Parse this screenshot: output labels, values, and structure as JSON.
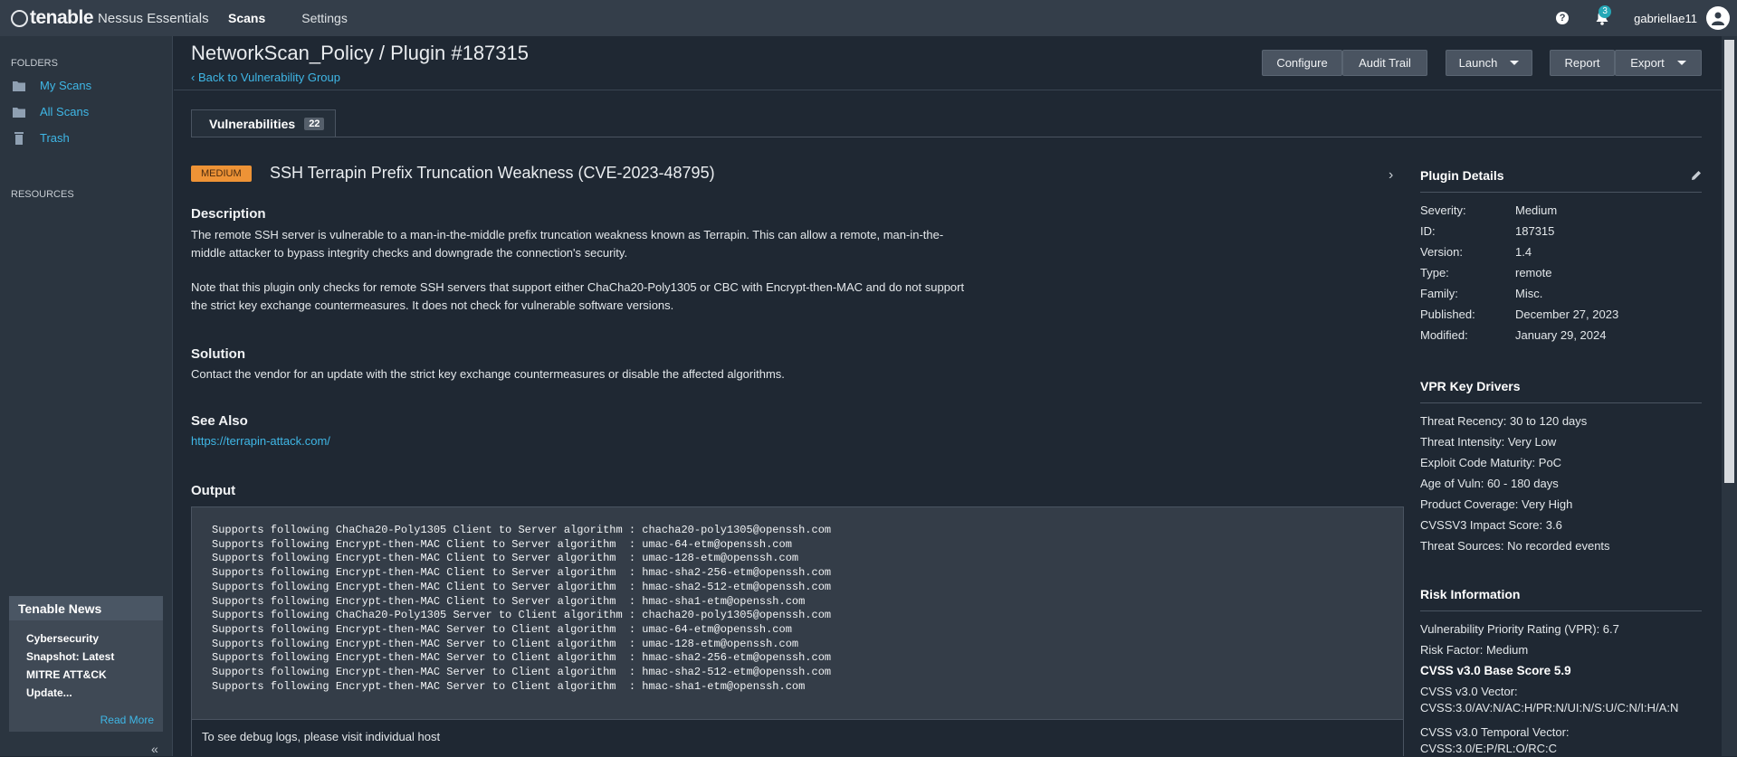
{
  "header": {
    "brand": "tenable",
    "product": "Nessus Essentials",
    "nav": [
      {
        "label": "Scans",
        "active": true
      },
      {
        "label": "Settings",
        "active": false
      }
    ],
    "notifications_count": "3",
    "username": "gabriellae11"
  },
  "sidebar": {
    "folders_label": "FOLDERS",
    "folders": [
      {
        "label": "My Scans",
        "icon": "folder-icon"
      },
      {
        "label": "All Scans",
        "icon": "folder-icon"
      },
      {
        "label": "Trash",
        "icon": "trash-icon"
      }
    ],
    "resources_label": "RESOURCES",
    "news": {
      "title": "Tenable News",
      "lines": [
        "Cybersecurity",
        "Snapshot: Latest",
        "MITRE ATT&CK",
        "Update..."
      ],
      "read_more": "Read More"
    }
  },
  "page": {
    "title": "NetworkScan_Policy / Plugin #187315",
    "back_link": "Back to Vulnerability Group",
    "buttons": {
      "configure": "Configure",
      "audit_trail": "Audit Trail",
      "launch": "Launch",
      "report": "Report",
      "export": "Export"
    },
    "tab": {
      "label": "Vulnerabilities",
      "count": "22"
    }
  },
  "vuln": {
    "severity": "MEDIUM",
    "severity_color": "#ee9336",
    "title": "SSH Terrapin Prefix Truncation Weakness (CVE-2023-48795)",
    "description_heading": "Description",
    "description_p1_l1": "The remote SSH server is vulnerable to a man-in-the-middle prefix truncation weakness known as Terrapin. This can allow a remote, man-in-the-",
    "description_p1_l2": "middle attacker to bypass integrity checks and downgrade the connection's security.",
    "description_p2_l1": "Note that this plugin only checks for remote SSH servers that support either ChaCha20-Poly1305 or CBC with Encrypt-then-MAC and do not support",
    "description_p2_l2": "the strict key exchange countermeasures. It does not check for vulnerable software versions.",
    "solution_heading": "Solution",
    "solution": "Contact the vendor for an update with the strict key exchange countermeasures or disable the affected algorithms.",
    "see_also_heading": "See Also",
    "see_also_link": "https://terrapin-attack.com/",
    "output_heading": "Output",
    "output_lines": [
      "Supports following ChaCha20-Poly1305 Client to Server algorithm : chacha20-poly1305@openssh.com",
      "Supports following Encrypt-then-MAC Client to Server algorithm  : umac-64-etm@openssh.com",
      "Supports following Encrypt-then-MAC Client to Server algorithm  : umac-128-etm@openssh.com",
      "Supports following Encrypt-then-MAC Client to Server algorithm  : hmac-sha2-256-etm@openssh.com",
      "Supports following Encrypt-then-MAC Client to Server algorithm  : hmac-sha2-512-etm@openssh.com",
      "Supports following Encrypt-then-MAC Client to Server algorithm  : hmac-sha1-etm@openssh.com",
      "Supports following ChaCha20-Poly1305 Server to Client algorithm : chacha20-poly1305@openssh.com",
      "Supports following Encrypt-then-MAC Server to Client algorithm  : umac-64-etm@openssh.com",
      "Supports following Encrypt-then-MAC Server to Client algorithm  : umac-128-etm@openssh.com",
      "Supports following Encrypt-then-MAC Server to Client algorithm  : hmac-sha2-256-etm@openssh.com",
      "Supports following Encrypt-then-MAC Server to Client algorithm  : hmac-sha2-512-etm@openssh.com",
      "Supports following Encrypt-then-MAC Server to Client algorithm  : hmac-sha1-etm@openssh.com"
    ],
    "output_footer": "To see debug logs, please visit individual host"
  },
  "plugin_details": {
    "heading": "Plugin Details",
    "rows": [
      {
        "k": "Severity:",
        "v": "Medium"
      },
      {
        "k": "ID:",
        "v": "187315"
      },
      {
        "k": "Version:",
        "v": "1.4"
      },
      {
        "k": "Type:",
        "v": "remote"
      },
      {
        "k": "Family:",
        "v": "Misc."
      },
      {
        "k": "Published:",
        "v": "December 27, 2023"
      },
      {
        "k": "Modified:",
        "v": "January 29, 2024"
      }
    ]
  },
  "vpr": {
    "heading": "VPR Key Drivers",
    "lines": [
      "Threat Recency: 30 to 120 days",
      "Threat Intensity: Very Low",
      "Exploit Code Maturity: PoC",
      "Age of Vuln: 60 - 180 days",
      "Product Coverage: Very High",
      "CVSSV3 Impact Score: 3.6",
      "Threat Sources: No recorded events"
    ]
  },
  "risk": {
    "heading": "Risk Information",
    "vpr_rating": "Vulnerability Priority Rating (VPR): 6.7",
    "risk_factor": "Risk Factor: Medium",
    "cvss_base": "CVSS v3.0 Base Score 5.9",
    "cvss_vector_label": "CVSS v3.0 Vector:",
    "cvss_vector": "CVSS:3.0/AV:N/AC:H/PR:N/UI:N/S:U/C:N/I:H/A:N",
    "cvss_temporal_label": "CVSS v3.0 Temporal Vector:",
    "cvss_temporal": "CVSS:3.0/E:P/RL:O/RC:C"
  }
}
